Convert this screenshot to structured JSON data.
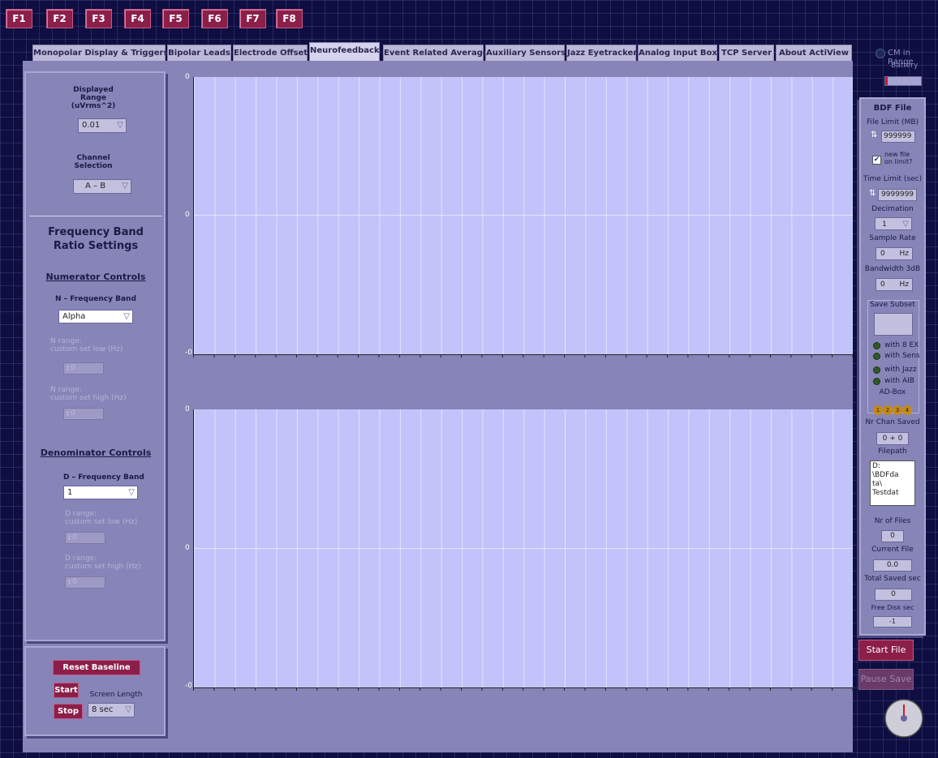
{
  "fkeys": [
    "F1",
    "F2",
    "F3",
    "F4",
    "F5",
    "F6",
    "F7",
    "F8"
  ],
  "tabs": [
    "Monopolar Display & Triggers",
    "Bipolar Leads",
    "Electrode Offset",
    "Neurofeedback",
    "Event Related Average",
    "Auxiliary Sensors",
    "Jazz Eyetracker",
    "Analog Input Box",
    "TCP Server",
    "About ActiView"
  ],
  "active_tab": "Neurofeedback",
  "status": {
    "cm_in_range": "CM in Range",
    "battery": "Battery"
  },
  "left": {
    "displayed_range_label": "Displayed\nRange\n(uVrms^2)",
    "displayed_range_value": "0.01",
    "channel_selection_label": "Channel\nSelection",
    "channel_selection_value": "A – B",
    "section_title": "Frequency Band\nRatio Settings",
    "numerator_title": "Numerator Controls",
    "n_band_label": "N – Frequency Band",
    "n_band_value": "Alpha",
    "n_low_label": "N range:\ncustom set low (Hz)",
    "n_low_value": "0",
    "n_high_label": "N range:\ncustom set high (Hz)",
    "n_high_value": "0",
    "denominator_title": "Denominator Controls",
    "d_band_label": "D – Frequency Band",
    "d_band_value": "1",
    "d_low_label": "D range:\ncustom set low (Hz)",
    "d_low_value": "0",
    "d_high_label": "D range:\ncustom set high (Hz)",
    "d_high_value": "0",
    "reset_baseline": "Reset Baseline",
    "start": "Start",
    "stop": "Stop",
    "screen_length_label": "Screen Length",
    "screen_length_value": "8 sec"
  },
  "charts": {
    "tick": "0"
  },
  "bdf": {
    "title": "BDF File",
    "file_limit_label": "File Limit (MB)",
    "file_limit_value": "999999",
    "new_file_label": "new file\non limit?",
    "time_limit_label": "Time Limit (sec)",
    "time_limit_value": "9999999",
    "decimation_label": "Decimation",
    "decimation_value": "1",
    "sample_rate_label": "Sample Rate",
    "sample_rate_value": "0",
    "sample_rate_unit": "Hz",
    "bandwidth_label": "Bandwidth 3dB",
    "bandwidth_value": "0",
    "bandwidth_unit": "Hz",
    "save_subset_label": "Save Subset",
    "leds": [
      "with 8 EX",
      "with Sens",
      "with Jazz",
      "with AIB"
    ],
    "adbox_label": "AD-Box",
    "adbox": [
      "1",
      "2",
      "3",
      "4"
    ],
    "nr_chan_label": "Nr Chan Saved",
    "nr_chan_value": "0 + 0",
    "filepath_label": "Filepath",
    "filepath_value": "D:\n\\BDFda\nta\\\nTestdat",
    "nr_files_label": "Nr of Files",
    "nr_files_value": "0",
    "current_file_label": "Current File",
    "current_file_value": "0.0",
    "total_saved_label": "Total Saved sec",
    "total_saved_value": "0",
    "free_disk_label": "Free Disk sec",
    "free_disk_value": "-1",
    "start_file": "Start File",
    "pause_save": "Pause Save"
  }
}
